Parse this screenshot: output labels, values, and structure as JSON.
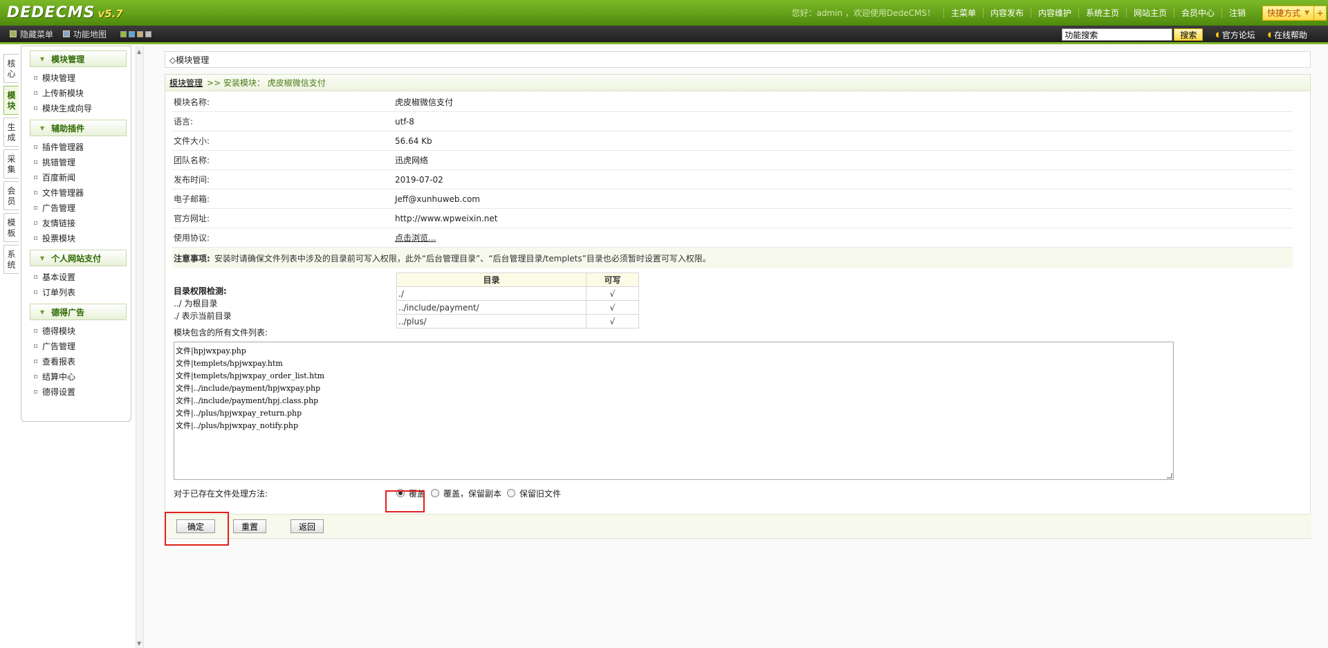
{
  "header": {
    "logo": "DEDECMS",
    "version": "v5.7",
    "welcome": "您好：admin ，欢迎使用DedeCMS！",
    "nav": [
      "主菜单",
      "内容发布",
      "内容维护",
      "系统主页",
      "网站主页",
      "会员中心",
      "注销"
    ],
    "shortcut": "快捷方式",
    "shortcut_plus": "+"
  },
  "subbar": {
    "hide_menu": "隐藏菜单",
    "func_map": "功能地图",
    "skin_colors": [
      "#8fbf3a",
      "#5ea7d8",
      "#c7b27a",
      "#bdbdbd"
    ],
    "search_value": "功能搜索",
    "search_button": "搜索",
    "forum": "官方论坛",
    "help": "在线帮助"
  },
  "vtabs": [
    {
      "label": "核心",
      "c1": "核",
      "c2": "心"
    },
    {
      "label": "模块",
      "c1": "模",
      "c2": "块"
    },
    {
      "label": "生成",
      "c1": "生",
      "c2": "成"
    },
    {
      "label": "采集",
      "c1": "采",
      "c2": "集"
    },
    {
      "label": "会员",
      "c1": "会",
      "c2": "员"
    },
    {
      "label": "模板",
      "c1": "模",
      "c2": "板"
    },
    {
      "label": "系统",
      "c1": "系",
      "c2": "统"
    }
  ],
  "menu": {
    "groups": [
      {
        "title": "模块管理",
        "items": [
          "模块管理",
          "上传新模块",
          "模块生成向导"
        ]
      },
      {
        "title": "辅助插件",
        "items": [
          "插件管理器",
          "挑错管理",
          "百度新闻",
          "文件管理器",
          "广告管理",
          "友情链接",
          "投票模块"
        ]
      },
      {
        "title": "个人网站支付",
        "items": [
          "基本设置",
          "订单列表"
        ]
      },
      {
        "title": "德得广告",
        "items": [
          "德得模块",
          "广告管理",
          "查看报表",
          "结算中心",
          "德得设置"
        ]
      }
    ]
  },
  "main": {
    "panel_title": "◇模块管理",
    "crumb_home": "模块管理",
    "crumb_rest": ">> 安装模块： 虎皮椒微信支付",
    "fields": [
      {
        "label": "模块名称:",
        "value": "虎皮椒微信支付"
      },
      {
        "label": "语言:",
        "value": "utf-8"
      },
      {
        "label": "文件大小:",
        "value": "56.64 Kb"
      },
      {
        "label": "团队名称:",
        "value": "迅虎网络"
      },
      {
        "label": "发布时间:",
        "value": "2019-07-02"
      },
      {
        "label": "电子邮箱:",
        "value": "Jeff@xunhuweb.com"
      },
      {
        "label": "官方网址:",
        "value": "http://www.wpweixin.net"
      },
      {
        "label": "使用协议:",
        "value": "点击浏览..."
      }
    ],
    "note_title": "注意事项:",
    "note_text": "安装时请确保文件列表中涉及的目录前可写入权限，此外“后台管理目录”、“后台管理目录/templets”目录也必须暂时设置可写入权限。",
    "perm_title": "目录权限检测:",
    "perm_line1": "../ 为根目录",
    "perm_line2": "./ 表示当前目录",
    "perm_table": {
      "headers": [
        "目录",
        "可写"
      ],
      "rows": [
        {
          "dir": "./",
          "ok": "√"
        },
        {
          "dir": "../include/payment/",
          "ok": "√"
        },
        {
          "dir": "../plus/",
          "ok": "√"
        }
      ]
    },
    "filelist_label": "模块包含的所有文件列表:",
    "files": [
      "文件|hpjwxpay.php",
      "文件|templets/hpjwxpay.htm",
      "文件|templets/hpjwxpay_order_list.htm",
      "文件|../include/payment/hpjwxpay.php",
      "文件|../include/payment/hpj.class.php",
      "文件|../plus/hpjwxpay_return.php",
      "文件|../plus/hpjwxpay_notify.php"
    ],
    "exist_label": "对于已存在文件处理方法:",
    "exist_options": [
      "覆盖",
      "覆盖，保留副本",
      "保留旧文件"
    ],
    "buttons": {
      "ok": "确定",
      "reset": "重置",
      "back": "返回"
    }
  },
  "colors": {
    "header_green": "#5f9e14",
    "highlight_red": "#e0201c"
  }
}
